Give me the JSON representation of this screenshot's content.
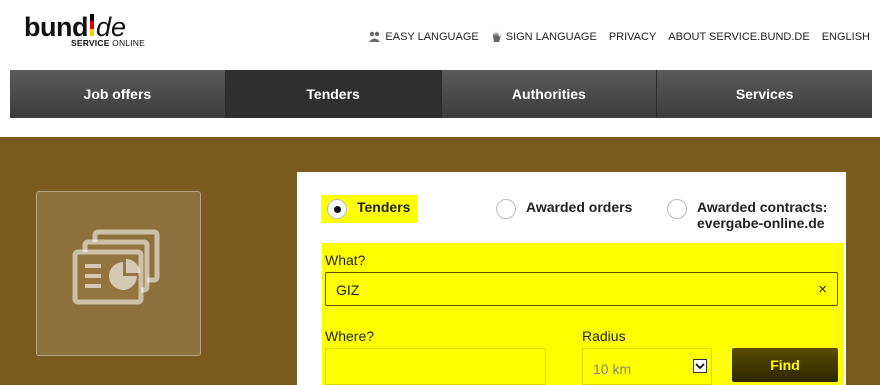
{
  "logo": {
    "bund": "bund",
    "de": "de",
    "sub_bold": "SERVICE",
    "sub_light": "ONLINE",
    "flag_colors": [
      "#000000",
      "#dd0000",
      "#ffcc00"
    ]
  },
  "meta_links": [
    {
      "label": "EASY LANGUAGE",
      "icon": "easy-language-icon"
    },
    {
      "label": "SIGN LANGUAGE",
      "icon": "sign-language-icon"
    },
    {
      "label": "PRIVACY"
    },
    {
      "label": "ABOUT SERVICE.BUND.DE"
    },
    {
      "label": "ENGLISH"
    }
  ],
  "nav": {
    "tabs": [
      "Job offers",
      "Tenders",
      "Authorities",
      "Services"
    ],
    "active": "Tenders"
  },
  "search": {
    "options": [
      "Tenders",
      "Awarded orders",
      "Awarded contracts: evergabe-online.de"
    ],
    "selected": "Tenders",
    "what_label": "What?",
    "what_value": "GIZ",
    "clear": "×",
    "where_label": "Where?",
    "where_value": "",
    "radius_label": "Radius",
    "radius_value": "10 km",
    "find_label": "Find"
  },
  "colors": {
    "hero_bg": "#7a5a1e",
    "highlight": "#ffff00",
    "nav_bg": "#3c3c3c",
    "find_bg": "#3a3000"
  }
}
